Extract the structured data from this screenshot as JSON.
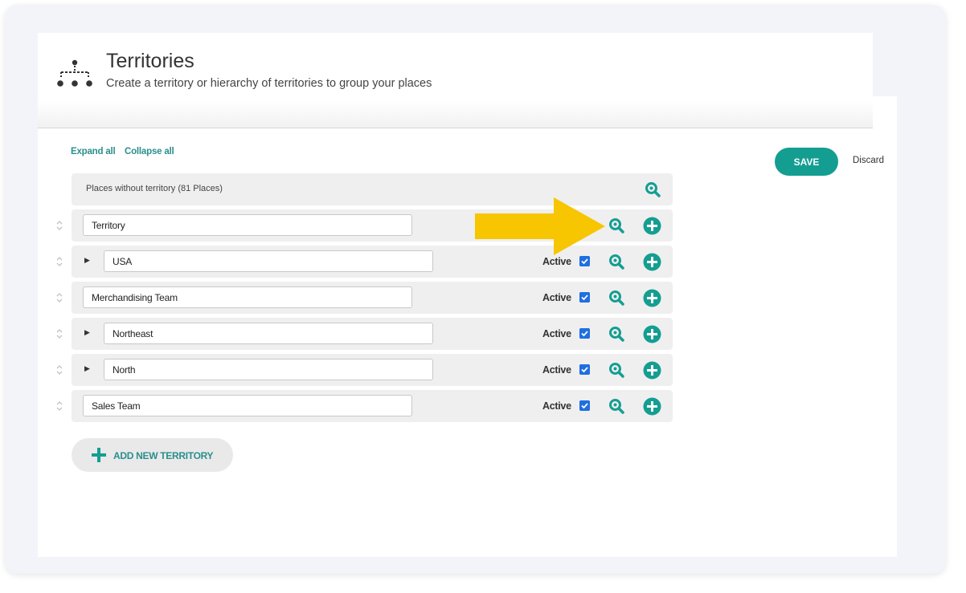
{
  "header": {
    "title": "Territories",
    "subtitle": "Create a territory or hierarchy of territories to group your places",
    "icon": "hierarchy-icon"
  },
  "toolbar": {
    "expand_all": "Expand all",
    "collapse_all": "Collapse all",
    "save_label": "SAVE",
    "discard_label": "Discard"
  },
  "places_without_territory": "Places without territory (81 Places)",
  "territories": [
    {
      "name": "Territory",
      "expandable": false,
      "active_label": "",
      "active": false
    },
    {
      "name": "USA",
      "expandable": true,
      "active_label": "Active",
      "active": true
    },
    {
      "name": "Merchandising Team",
      "expandable": false,
      "active_label": "Active",
      "active": true
    },
    {
      "name": "Northeast",
      "expandable": true,
      "active_label": "Active",
      "active": true
    },
    {
      "name": "North",
      "expandable": true,
      "active_label": "Active",
      "active": true
    },
    {
      "name": "Sales Team",
      "expandable": false,
      "active_label": "Active",
      "active": true
    }
  ],
  "add_territory_label": "ADD NEW TERRITORY",
  "colors": {
    "accent": "#149e92",
    "link": "#2a8f8c",
    "checkbox": "#1f6fe0",
    "callout_arrow": "#f7c600"
  }
}
